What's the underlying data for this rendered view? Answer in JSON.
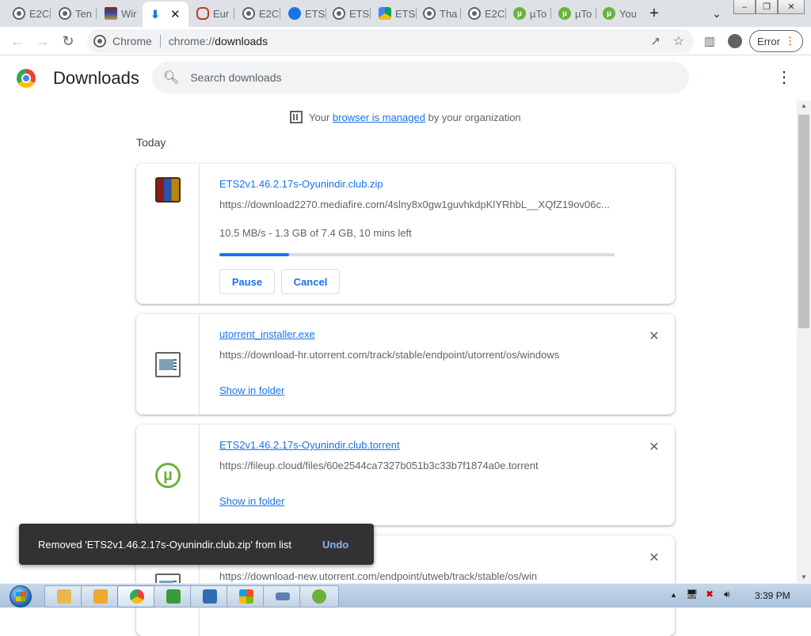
{
  "tabs": [
    {
      "label": "E2C",
      "icon": "globe-icon"
    },
    {
      "label": "Ten",
      "icon": "globe-icon"
    },
    {
      "label": "Wir",
      "icon": "winrar-icon"
    },
    {
      "label": "",
      "icon": "download-icon",
      "active": true
    },
    {
      "label": "Eur",
      "icon": "eu-icon"
    },
    {
      "label": "E2C",
      "icon": "globe-icon"
    },
    {
      "label": "ETS",
      "icon": "ets-icon"
    },
    {
      "label": "ETS",
      "icon": "globe-icon"
    },
    {
      "label": "ETS",
      "icon": "drive-icon"
    },
    {
      "label": "Tha",
      "icon": "globe-icon"
    },
    {
      "label": "E2C",
      "icon": "globe-icon"
    },
    {
      "label": "µTo",
      "icon": "utorrent-icon"
    },
    {
      "label": "µTo",
      "icon": "utorrent-icon"
    },
    {
      "label": "You",
      "icon": "utorrent-icon"
    }
  ],
  "toolbar": {
    "omnibox_brand": "Chrome",
    "omnibox_url_prefix": "chrome://",
    "omnibox_url_path": "downloads",
    "error_label": "Error"
  },
  "downloads_page": {
    "title": "Downloads",
    "search_placeholder": "Search downloads",
    "managed_prefix": "Your",
    "managed_link": "browser is managed",
    "managed_suffix": "by your organization",
    "section_label": "Today"
  },
  "items": [
    {
      "filename": "ETS2v1.46.2.17s-Oyunindir.club.zip",
      "url": "https://download2270.mediafire.com/4slny8x0gw1guvhkdpKlYRhbL__XQfZ19ov06c...",
      "status": "10.5 MB/s - 1.3 GB of 7.4 GB, 10 mins left",
      "progress_pct": 17.6,
      "pause_label": "Pause",
      "cancel_label": "Cancel",
      "icon": "winrar-archive-icon"
    },
    {
      "filename": "utorrent_installer.exe",
      "url": "https://download-hr.utorrent.com/track/stable/endpoint/utorrent/os/windows",
      "link_label": "Show in folder",
      "icon": "executable-icon"
    },
    {
      "filename": "ETS2v1.46.2.17s-Oyunindir.club.torrent",
      "url": "https://fileup.cloud/files/60e2544ca7327b051b3c33b7f1874a0e.torrent",
      "link_label": "Show in folder",
      "icon": "utorrent-icon"
    },
    {
      "filename": "",
      "url": "https://download-new.utorrent.com/endpoint/utweb/track/stable/os/win",
      "icon": "executable-icon"
    }
  ],
  "toast": {
    "message": "Removed 'ETS2v1.46.2.17s-Oyunindir.club.zip' from list",
    "action": "Undo"
  },
  "taskbar": {
    "clock": "3:39 PM",
    "apps": [
      "explorer",
      "media-player",
      "chrome",
      "app-green",
      "app-blue",
      "app-office",
      "keyboard",
      "utorrent"
    ]
  }
}
